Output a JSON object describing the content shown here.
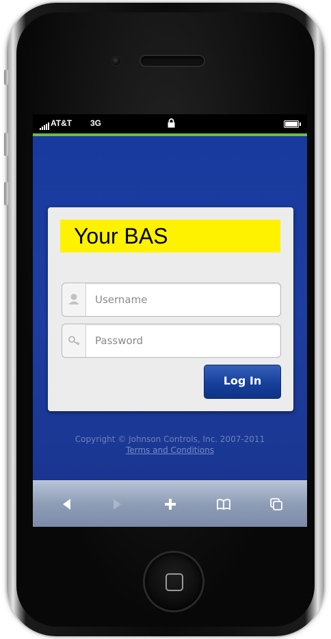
{
  "status_bar": {
    "carrier": "AT&T",
    "network": "3G",
    "signal_icon": "signal-bars-icon",
    "lock_icon": "lock-icon",
    "battery_icon": "battery-icon",
    "battery_level": 1.0
  },
  "login": {
    "brand": "Your BAS",
    "brand_background": "#fef200",
    "username_placeholder": "Username",
    "password_placeholder": "Password",
    "username_icon": "user-icon",
    "password_icon": "key-icon",
    "login_button": "Log In"
  },
  "footer": {
    "copyright": "Copyright © Johnson Controls, Inc. 2007-2011",
    "terms_link": "Terms and Conditions"
  },
  "toolbar": {
    "icons": [
      "back-icon",
      "forward-icon",
      "add-icon",
      "bookmarks-icon",
      "pages-icon"
    ]
  },
  "colors": {
    "screen_background": "#1b3690",
    "accent_line": "#6abd45",
    "button": "#17409b"
  }
}
